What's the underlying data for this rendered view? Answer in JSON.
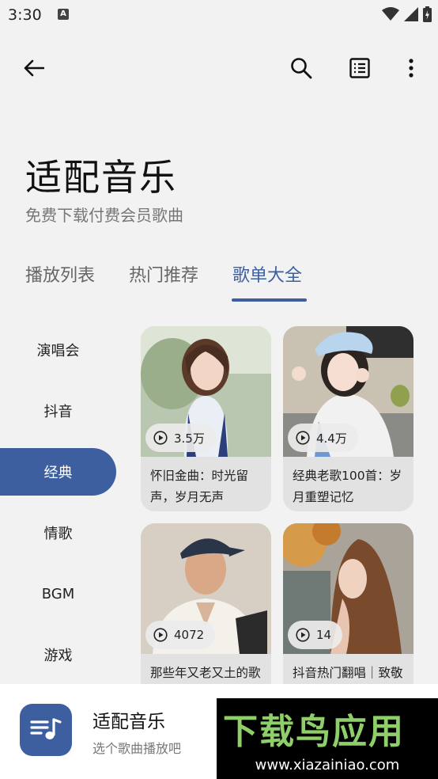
{
  "status_bar": {
    "time": "3:30",
    "notification_glyph": "A"
  },
  "toolbar": {
    "back_icon": "back-arrow-icon",
    "search_icon": "search-icon",
    "list_icon": "list-icon",
    "more_icon": "more-vert-icon"
  },
  "header": {
    "title": "适配音乐",
    "subtitle": "免费下载付费会员歌曲"
  },
  "tabs": [
    {
      "label": "播放列表",
      "active": false
    },
    {
      "label": "热门推荐",
      "active": false
    },
    {
      "label": "歌单大全",
      "active": true
    }
  ],
  "categories": [
    {
      "label": "演唱会",
      "active": false
    },
    {
      "label": "抖音",
      "active": false
    },
    {
      "label": "经典",
      "active": true
    },
    {
      "label": "情歌",
      "active": false
    },
    {
      "label": "BGM",
      "active": false
    },
    {
      "label": "游戏",
      "active": false
    }
  ],
  "playlists": [
    {
      "plays": "3.5万",
      "title": "怀旧金曲：时光留声，岁月无声"
    },
    {
      "plays": "4.4万",
      "title": "经典老歌100首：岁月重塑记忆"
    },
    {
      "plays": "4072",
      "title": "那些年又老又土的歌"
    },
    {
      "plays": "14",
      "title": "抖音热门翻唱｜致敬"
    }
  ],
  "player": {
    "title": "适配音乐",
    "subtitle": "选个歌曲播放吧",
    "icon": "music-note-icon"
  },
  "watermark": {
    "main": "下载鸟应用",
    "url": "www.xiazainiao.com"
  },
  "colors": {
    "accent": "#3d5fa0",
    "background": "#f2f2f2",
    "card": "#e2e2e2"
  }
}
